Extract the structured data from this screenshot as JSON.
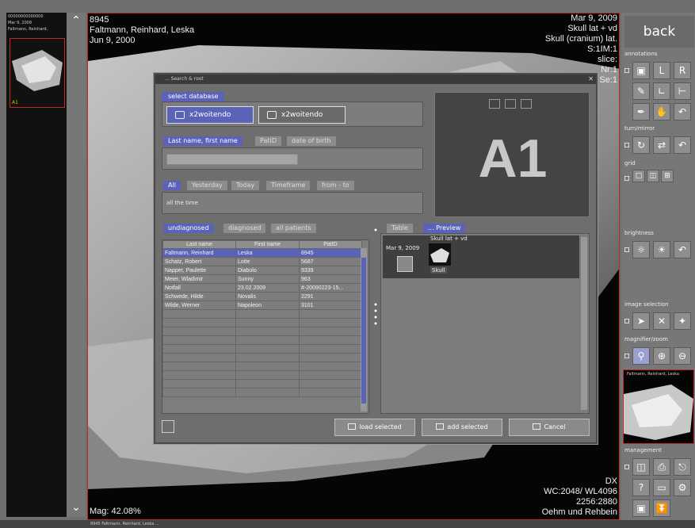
{
  "thumbs": {
    "header_line1": "00000000000000",
    "header_line2": "Mar 9, 2009",
    "header_line3": "Faltmann, Reinhard,",
    "tag": "A1"
  },
  "overlay": {
    "top_left": [
      "8945",
      "Faltmann, Reinhard, Leska",
      "Jun 9, 2000"
    ],
    "top_right": [
      "Mar 9, 2009",
      "Skull lat + vd",
      "Skull (cranium) lat.",
      "S:1IM:1",
      "slice:",
      "Nr:1",
      "Se:1"
    ],
    "bottom_left": "Mag: 42.08%",
    "bottom_right": [
      "DX",
      "WC:2048/ WL4096",
      "2256:2880",
      "Oehm und Rehbein"
    ]
  },
  "dialog": {
    "title": "... Search & root",
    "select_database_label": "select database",
    "db_buttons": [
      "x2woitendo",
      "x2woitendo"
    ],
    "name_tabs": [
      "Last name, first name",
      "PatID",
      "date of birth"
    ],
    "time_tabs": [
      "All",
      "Yesterday",
      "Today",
      "Timeframe",
      "from - to"
    ],
    "time_value": "all the time",
    "list_tabs": [
      "undiagnosed",
      "diagnosed",
      "all patients"
    ],
    "view_tabs": [
      "Table",
      "... Preview"
    ],
    "columns": [
      "Last name",
      "First name",
      "PatID"
    ],
    "rows": [
      [
        "Faltmann, Reinhard",
        "Leska",
        "8945"
      ],
      [
        "Schatz, Robert",
        "Lotte",
        "5687"
      ],
      [
        "Napper, Paulette",
        "Diabolo",
        "9339"
      ],
      [
        "Meier, Wladimir",
        "Sunny",
        "963"
      ],
      [
        "Notfall",
        "23.02.2009",
        "#-20090223-15..."
      ],
      [
        "Schwede, Hilde",
        "Novalis",
        "2291"
      ],
      [
        "Wilde, Werner",
        "Napoleon",
        "3101"
      ]
    ],
    "preview": {
      "date": "Mar 9, 2009",
      "series": "Skull lat + vd",
      "thumb_label": "Skull"
    },
    "a1": "A1",
    "buttons": {
      "load": "load selected",
      "add": "add selected",
      "cancel": "Cancel"
    }
  },
  "tools": {
    "back": "back",
    "sections": [
      "annotations",
      "turn/mirror",
      "grid",
      "brightness",
      "image selection",
      "magnifier/zoom",
      "management"
    ],
    "annot_letters": [
      "L",
      "R"
    ],
    "mini_caption": "Faltmann, Reinhard, Leska"
  },
  "bottom": "8945 Faltmann, Reinhard, Leska ..."
}
